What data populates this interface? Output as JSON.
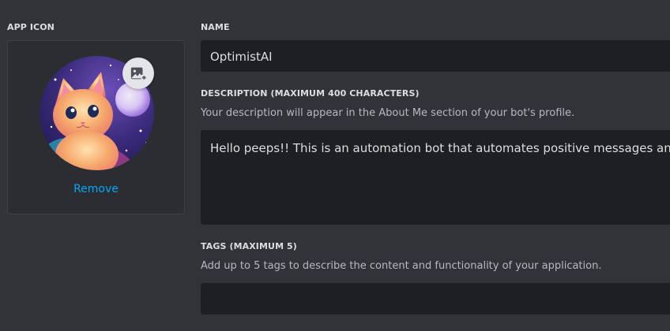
{
  "app_icon": {
    "label": "APP ICON",
    "remove_label": "Remove"
  },
  "name": {
    "label": "NAME",
    "value": "OptimistAI"
  },
  "description": {
    "label": "DESCRIPTION (MAXIMUM 400 CHARACTERS)",
    "help": "Your description will appear in the About Me section of your bot's profile.",
    "value": "Hello peeps!! This is an automation bot that automates positive messages and quotes"
  },
  "tags": {
    "label": "TAGS (MAXIMUM 5)",
    "help": "Add up to 5 tags to describe the content and functionality of your application.",
    "value": ""
  },
  "colors": {
    "background": "#313338",
    "input": "#1e1f22",
    "link": "#00a8fc"
  },
  "icons": {
    "upload": "image-upload-icon"
  }
}
